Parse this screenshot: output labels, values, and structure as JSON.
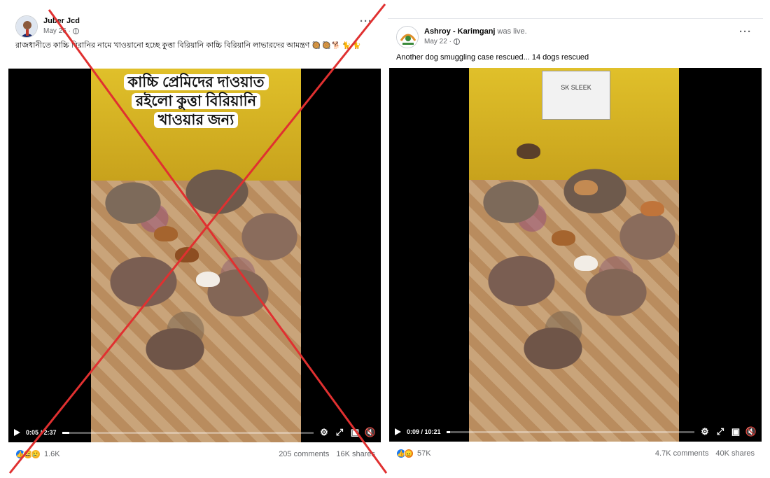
{
  "colors": {
    "facebook_blue": "#1877f2",
    "cross_red": "#e03030",
    "text_secondary": "#65676b"
  },
  "left_post": {
    "author": "Juber Jcd",
    "date": "May 26 ·",
    "caption": "রাজধানীতে কাচ্চি বিরানির নামে খাওয়ানো হচ্ছে কুত্তা বিরিয়ানি কাচ্চি বিরিয়ানি লাভারদের আমন্ত্রণ",
    "emoji_row": "🥘🥘🐕🐈🐈",
    "more_label": "···",
    "video_overlay": [
      "কাচ্চি প্রেমিদের দাওয়াত",
      "রইলো কুত্তা বিরিয়ানি",
      "খাওয়ার জন্য"
    ],
    "time_display": "0:05 / 2:37",
    "progress": 0.03,
    "reaction_count": "1.6K",
    "comments": "205 comments",
    "shares": "16K shares"
  },
  "right_post": {
    "author": "Ashroy - Karimganj",
    "author_suffix": " was live.",
    "date": "May 22 ·",
    "caption": "Another dog smuggling case rescued... 14 dogs rescued",
    "more_label": "···",
    "sign_text": "SK SLEEK",
    "time_display": "0:09 / 10:21",
    "progress": 0.015,
    "reaction_count": "57K",
    "comments": "4.7K comments",
    "shares": "40K shares"
  },
  "icons": {
    "play": "play-icon",
    "settings": "gear-icon",
    "fullscreen": "expand-icon",
    "miniplayer": "picture-in-picture-icon",
    "volume": "volume-muted-icon"
  }
}
